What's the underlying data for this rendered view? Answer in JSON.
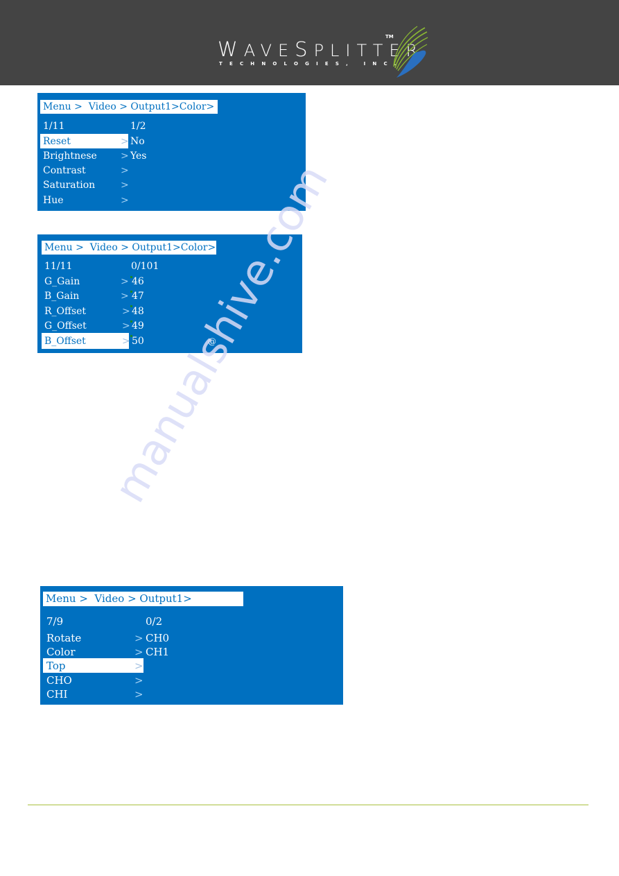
{
  "header": {
    "logo": {
      "name": "WaveSplitter",
      "name_parts": [
        "W",
        "AVE",
        "S",
        "PLITTER"
      ],
      "trademark": "TM",
      "subtitle": "TECHNOLOGIES, INC.",
      "icon": "wavesplitter-swoosh-logo"
    },
    "background_color": "#444444"
  },
  "panels": [
    {
      "breadcrumb": "Menu >  Video > Output1>Color>",
      "index": "1/11",
      "value_index": "1/2",
      "items": [
        {
          "label": "Reset",
          "selected": true
        },
        {
          "label": "Brightnese",
          "selected": false
        },
        {
          "label": "Contrast",
          "selected": false
        },
        {
          "label": "Saturation",
          "selected": false
        },
        {
          "label": "Hue",
          "selected": false
        }
      ],
      "values": [
        "No",
        "Yes"
      ]
    },
    {
      "breadcrumb": "Menu >  Video > Output1>Color>",
      "index": "11/11",
      "value_index": "0/101",
      "items": [
        {
          "label": "G_Gain",
          "selected": false
        },
        {
          "label": "B_Gain",
          "selected": false
        },
        {
          "label": "R_Offset",
          "selected": false
        },
        {
          "label": "G_Offset",
          "selected": false
        },
        {
          "label": "B_Offset",
          "selected": true
        }
      ],
      "values": [
        "46",
        "47",
        "48",
        "49",
        "50"
      ],
      "extra_glyph": "@"
    },
    {
      "breadcrumb": "Menu >  Video > Output1>",
      "index": "7/9",
      "value_index": "0/2",
      "items": [
        {
          "label": "Rotate",
          "selected": false
        },
        {
          "label": "Color",
          "selected": false
        },
        {
          "label": "Top",
          "selected": true
        },
        {
          "label": "CHO",
          "selected": false
        },
        {
          "label": "CHI",
          "selected": false
        }
      ],
      "values": [
        "CH0",
        "CH1"
      ]
    }
  ],
  "chevron": ">",
  "colors": {
    "osd_blue": "#0070c0",
    "highlight": "#ffffff",
    "footer_rule": "#a9c13e"
  },
  "watermark": "manualshive.com"
}
